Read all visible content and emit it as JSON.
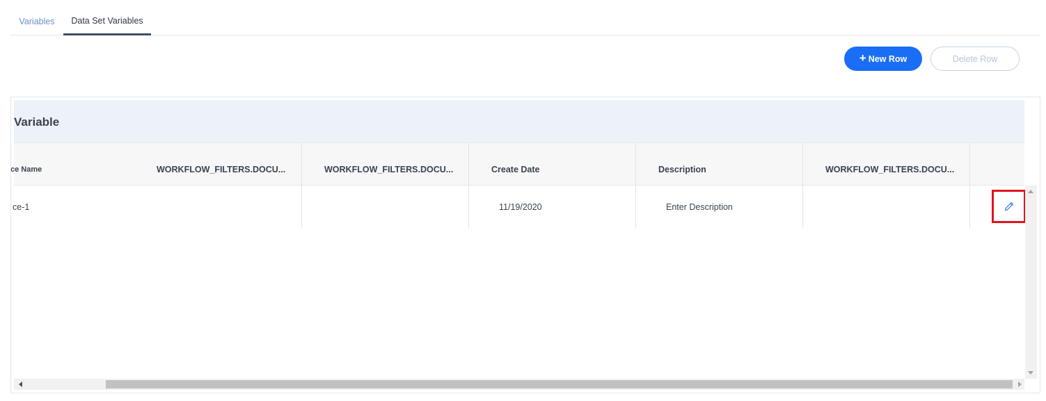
{
  "tabs": [
    {
      "label": "Variables",
      "active": false
    },
    {
      "label": "Data Set Variables",
      "active": true
    }
  ],
  "toolbar": {
    "new_row_icon": "+",
    "new_row_label": "New Row",
    "delete_row_label": "Delete Row"
  },
  "panel": {
    "title": "Variable"
  },
  "table": {
    "columns": [
      "ce Name",
      "WORKFLOW_FILTERS.DOCU...",
      "WORKFLOW_FILTERS.DOCU...",
      "Create Date",
      "Description",
      "WORKFLOW_FILTERS.DOCU..."
    ],
    "rows": [
      [
        "ce-1",
        "",
        "",
        "11/19/2020",
        "Enter Description",
        ""
      ]
    ],
    "row_action_icon": "pencil-edit-icon"
  },
  "colors": {
    "accent": "#1a6ef5",
    "highlight_box": "#e0141e",
    "title_bar": "#edf2f9"
  }
}
